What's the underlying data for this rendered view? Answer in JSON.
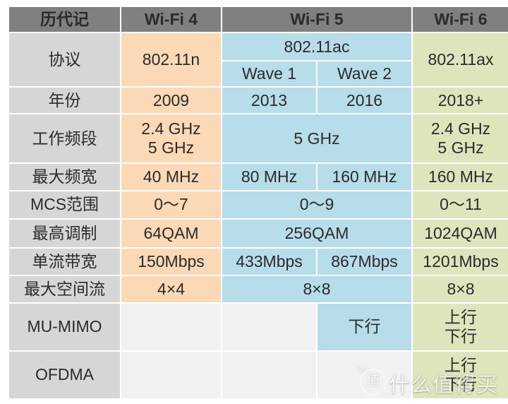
{
  "table": {
    "header": {
      "corner_label": "历代记",
      "columns": [
        {
          "label": "Wi-Fi 4",
          "accent": "#fbd9b6"
        },
        {
          "label": "Wi-Fi 5",
          "accent": "#b7dcea"
        },
        {
          "label": "Wi-Fi 6",
          "accent": "#dde5bd"
        }
      ]
    },
    "subcolumns": {
      "wifi5_wave1": "Wave 1",
      "wifi5_wave2": "Wave 2"
    },
    "rows": [
      {
        "label": "协议",
        "wifi4": "802.11n",
        "wifi5": "802.11ac",
        "wifi5_wave1": "Wave 1",
        "wifi5_wave2": "Wave 2",
        "wifi6": "802.11ax"
      },
      {
        "label": "年份",
        "wifi4": "2009",
        "wifi5_wave1": "2013",
        "wifi5_wave2": "2016",
        "wifi6": "2018+"
      },
      {
        "label": "工作频段",
        "wifi4_line1": "2.4 GHz",
        "wifi4_line2": "5 GHz",
        "wifi5": "5 GHz",
        "wifi6_line1": "2.4 GHz",
        "wifi6_line2": "5 GHz"
      },
      {
        "label": "最大频宽",
        "wifi4": "40 MHz",
        "wifi5_wave1": "80 MHz",
        "wifi5_wave2": "160 MHz",
        "wifi6": "160 MHz"
      },
      {
        "label": "MCS范围",
        "wifi4": "0～7",
        "wifi5": "0～9",
        "wifi6": "0～11"
      },
      {
        "label": "最高调制",
        "wifi4": "64QAM",
        "wifi5": "256QAM",
        "wifi6": "1024QAM"
      },
      {
        "label": "单流带宽",
        "wifi4": "150Mbps",
        "wifi5_wave1": "433Mbps",
        "wifi5_wave2": "867Mbps",
        "wifi6": "1201Mbps"
      },
      {
        "label": "最大空间流",
        "wifi4": "4×4",
        "wifi5": "8×8",
        "wifi6": "8×8"
      },
      {
        "label": "MU-MIMO",
        "wifi4": "",
        "wifi5_wave1": "",
        "wifi5_wave2": "下行",
        "wifi6_line1": "上行",
        "wifi6_line2": "下行"
      },
      {
        "label": "OFDMA",
        "wifi4": "",
        "wifi5_wave1": "",
        "wifi5_wave2": "",
        "wifi6_line1": "上行",
        "wifi6_line2": "下行"
      }
    ]
  },
  "watermark": {
    "badge": "值",
    "text": "什么值得买",
    "sub": "SM"
  }
}
